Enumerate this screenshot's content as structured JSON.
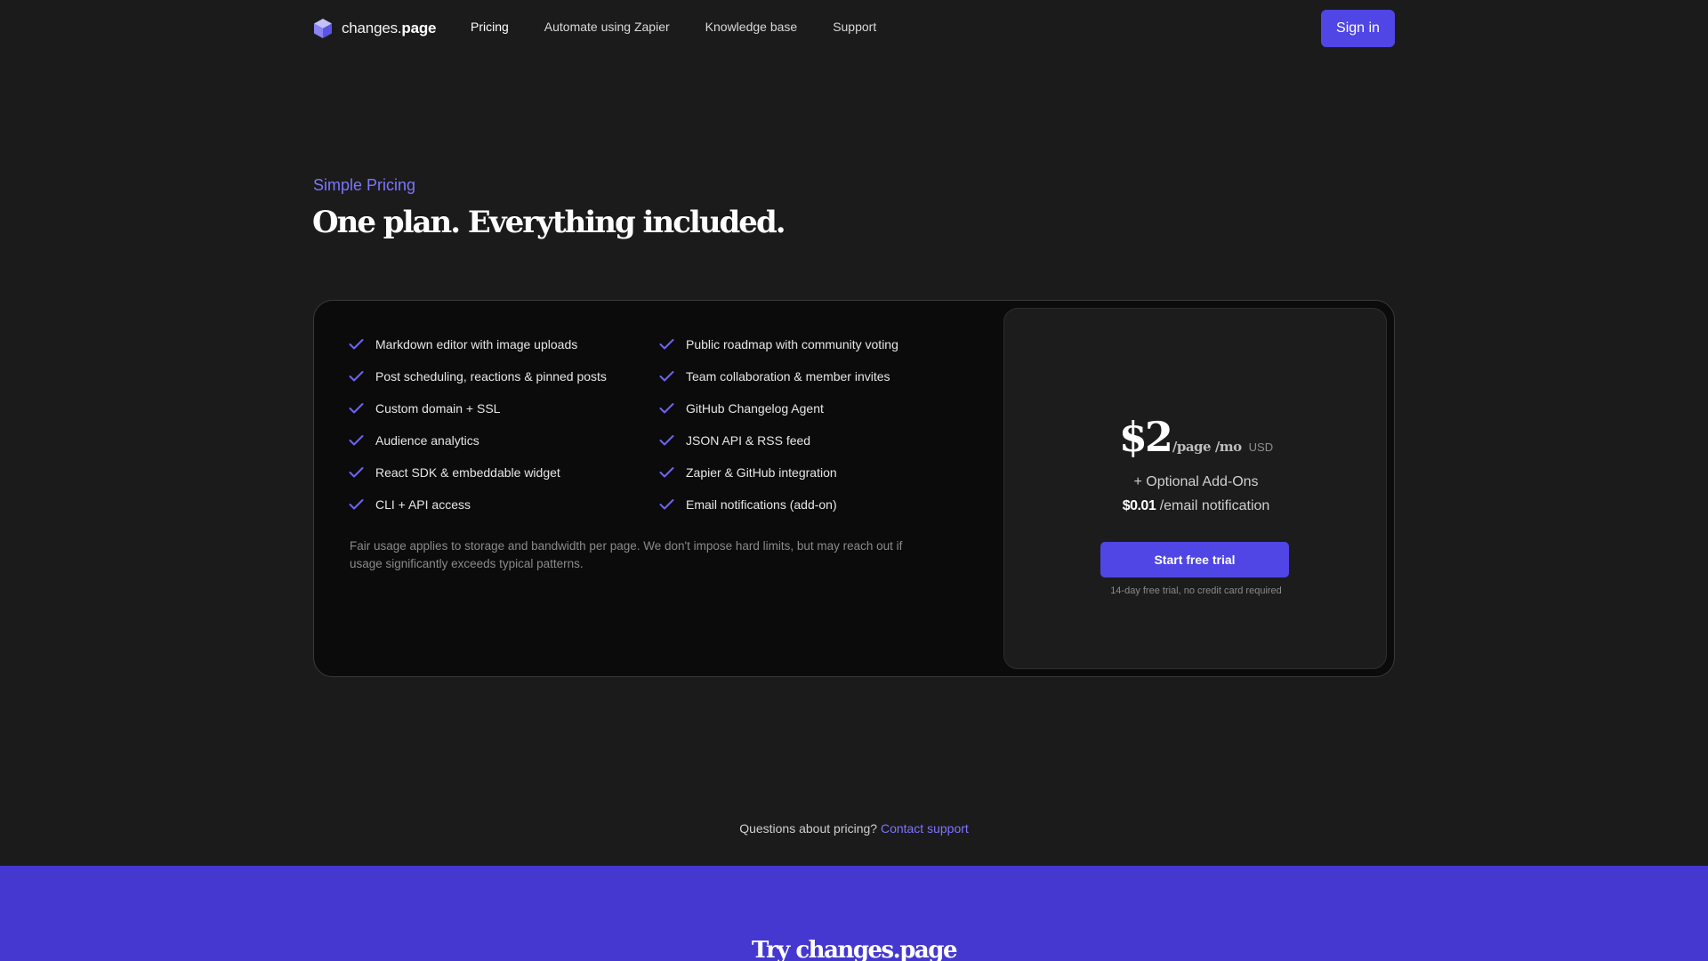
{
  "nav": {
    "logo": {
      "prefix": "changes.",
      "suffix": "page"
    },
    "links": [
      "Pricing",
      "Automate using Zapier",
      "Knowledge base",
      "Support"
    ],
    "active_link": "Pricing",
    "signin_label": "Sign in"
  },
  "hero": {
    "eyebrow": "Simple Pricing",
    "headline": "One plan. Everything included."
  },
  "features": [
    "Markdown editor with image uploads",
    "Public roadmap with community voting",
    "Post scheduling, reactions & pinned posts",
    "Team collaboration & member invites",
    "Custom domain + SSL",
    "GitHub Changelog Agent",
    "Audience analytics",
    "JSON API & RSS feed",
    "React SDK & embeddable widget",
    "Zapier & GitHub integration",
    "CLI + API access",
    "Email notifications (add-on)"
  ],
  "fair_usage": "Fair usage applies to storage and bandwidth per page. We don't impose hard limits, but may reach out if usage significantly exceeds typical patterns.",
  "price": {
    "amount": "$2",
    "unit": "/page /mo",
    "currency": "USD",
    "addons_label": "+ Optional Add-Ons",
    "email_amount": "$0.01",
    "email_unit": "/email notification",
    "cta_label": "Start free trial",
    "trial_note": "14-day free trial, no credit card required"
  },
  "questions": {
    "text": "Questions about pricing?",
    "link": "Contact support"
  },
  "cta_band": {
    "title_prefix": "Try changes.",
    "title_suffix": "page"
  },
  "colors": {
    "accent": "#4f46e5",
    "accent_text": "#7c75ff",
    "band": "#4538d0",
    "background": "#1b1b1b"
  },
  "icons": {
    "logo": "cube-icon",
    "feature": "check-icon"
  }
}
